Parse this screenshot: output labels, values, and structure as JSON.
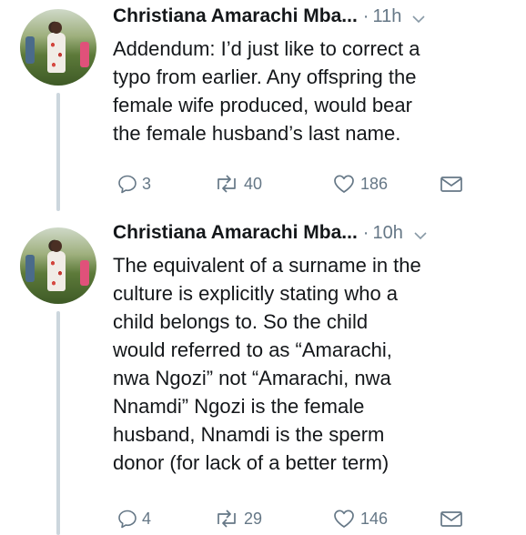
{
  "tweets": [
    {
      "author": "Christiana Amarachi Mba...",
      "time": "11h",
      "text": "Addendum: I’d just like to correct a\ntypo from earlier. Any offspring the\nfemale wife produced, would bear\nthe female husband’s last name.",
      "replies": "3",
      "retweets": "40",
      "likes": "186"
    },
    {
      "author": "Christiana Amarachi Mba...",
      "time": "10h",
      "text": "The equivalent of a surname in the\nculture is explicitly stating who a\nchild belongs to. So the child\nwould referred to as “Amarachi,\nnwa Ngozi” not “Amarachi, nwa\nNnamdi” Ngozi is the female\nhusband, Nnamdi is the sperm\ndonor (for lack of a better term)",
      "replies": "4",
      "retweets": "29",
      "likes": "146"
    }
  ],
  "separator": "·",
  "colors": {
    "text": "#14171a",
    "muted": "#657786",
    "thread": "#ccd6dd"
  }
}
